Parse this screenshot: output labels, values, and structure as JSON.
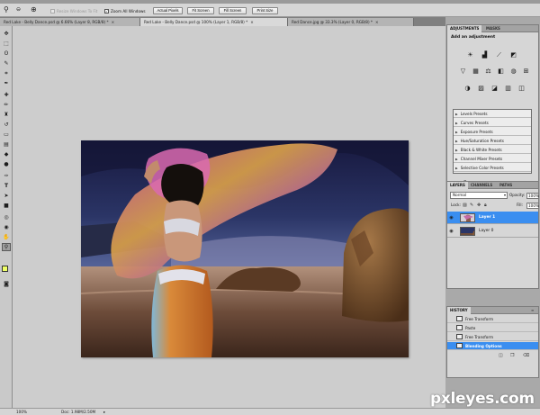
{
  "options_bar": {
    "tool_icon": "zoom-icon",
    "resize_windows_label": "Resize Windows To Fit",
    "zoom_all_windows_label": "Zoom All Windows",
    "actual_pixels_label": "Actual Pixels",
    "fit_screen_label": "Fit Screen",
    "fill_screen_label": "Fill Screen",
    "print_size_label": "Print Size"
  },
  "document_tabs": [
    {
      "label": "Red Lake - Belly Dance.psd @ 6.66% (Layer 8, RGB/8) *",
      "active": false
    },
    {
      "label": "Red Lake - Belly Dance.psd @ 100% (Layer 1, RGB/8) *",
      "active": true
    },
    {
      "label": "Red Dance.jpg @ 33.3% (Layer 0, RGB/8) *",
      "active": false
    }
  ],
  "colors": {
    "foreground": "#efff66",
    "background": "#ffffff",
    "selection": "#3a8ef0"
  },
  "adjustments_panel": {
    "tabs": [
      "ADJUSTMENTS",
      "MASKS"
    ],
    "title": "Add an adjustment",
    "icons": [
      "brightness-icon",
      "levels-icon",
      "curves-icon",
      "exposure-icon",
      "vibrance-icon",
      "hue-saturation-icon",
      "color-balance-icon",
      "black-white-icon",
      "photo-filter-icon",
      "channel-mixer-icon",
      "invert-icon",
      "posterize-icon",
      "threshold-icon",
      "gradient-map-icon",
      "selective-color-icon"
    ],
    "presets": [
      "Levels Presets",
      "Curves Presets",
      "Exposure Presets",
      "Hue/Saturation Presets",
      "Black & White Presets",
      "Channel Mixer Presets",
      "Selective Color Presets"
    ]
  },
  "layers_panel": {
    "tabs": [
      "LAYERS",
      "CHANNELS",
      "PATHS"
    ],
    "blend_mode": "Normal",
    "opacity_label": "Opacity:",
    "opacity_value": "100%",
    "lock_label": "Lock:",
    "fill_label": "Fill:",
    "fill_value": "100%",
    "layers": [
      {
        "name": "Layer 1",
        "selected": true
      },
      {
        "name": "Layer 0",
        "selected": false
      }
    ]
  },
  "history_panel": {
    "tab": "HISTORY",
    "items": [
      {
        "name": "Free Transform",
        "selected": false
      },
      {
        "name": "Paste",
        "selected": false
      },
      {
        "name": "Free Transform",
        "selected": false
      },
      {
        "name": "Blending Options",
        "selected": true
      }
    ]
  },
  "status_bar": {
    "zoom": "100%",
    "doc_info": "Doc: 1.98M/2.50M"
  },
  "watermark": "pxleyes.com"
}
